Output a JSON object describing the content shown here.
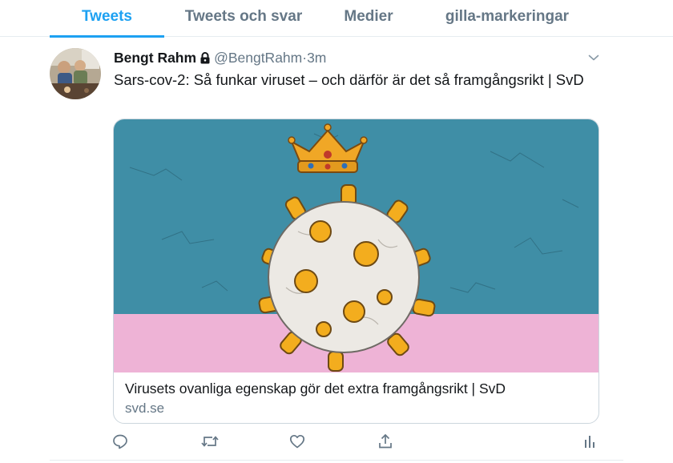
{
  "tabs": [
    {
      "label": "Tweets",
      "active": true
    },
    {
      "label": "Tweets och svar",
      "active": false
    },
    {
      "label": "Medier",
      "active": false
    },
    {
      "label": "gilla-markeringar",
      "active": false
    }
  ],
  "tweet": {
    "display_name": "Bengt Rahm",
    "handle": "@BengtRahm",
    "separator": "·",
    "time": "3m",
    "text": "Sars-cov-2: Så funkar viruset – och därför är det så framgångsrikt | SvD",
    "card": {
      "title": "Virusets ovanliga egenskap gör det extra framgångsrikt | SvD",
      "domain": "svd.se"
    },
    "icons": {
      "lock": "lock-icon",
      "menu": "chevron-down-icon",
      "reply": "reply-icon",
      "retweet": "retweet-icon",
      "like": "heart-icon",
      "share": "share-icon",
      "analytics": "analytics-icon"
    }
  },
  "colors": {
    "accent": "#1da1f2",
    "muted": "#657786",
    "text": "#14171a",
    "card_sky": "#3f8ea6",
    "card_floor": "#eeb3d6"
  }
}
